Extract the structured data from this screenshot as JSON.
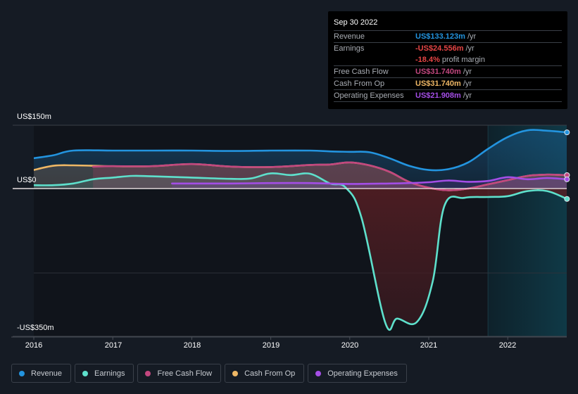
{
  "tooltip": {
    "date": "Sep 30 2022",
    "rows": [
      {
        "label": "Revenue",
        "value": "US$133.123m",
        "unit": "/yr",
        "color": "#2394df"
      },
      {
        "label": "Earnings",
        "value": "-US$24.556m",
        "unit": "/yr",
        "color": "#e64545"
      },
      {
        "label": "",
        "value": "-18.4%",
        "unit": "profit margin",
        "color": "#e64545"
      },
      {
        "label": "Free Cash Flow",
        "value": "US$31.740m",
        "unit": "/yr",
        "color": "#c2477f"
      },
      {
        "label": "Cash From Op",
        "value": "US$31.740m",
        "unit": "/yr",
        "color": "#eeb765"
      },
      {
        "label": "Operating Expenses",
        "value": "US$21.908m",
        "unit": "/yr",
        "color": "#a44ee6"
      }
    ]
  },
  "legend": [
    {
      "label": "Revenue",
      "color": "#2394df"
    },
    {
      "label": "Earnings",
      "color": "#5ee0cc"
    },
    {
      "label": "Free Cash Flow",
      "color": "#c2477f"
    },
    {
      "label": "Cash From Op",
      "color": "#eeb765"
    },
    {
      "label": "Operating Expenses",
      "color": "#a44ee6"
    }
  ],
  "chart_data": {
    "type": "line",
    "title": "",
    "xlabel": "",
    "ylabel": "",
    "y_tick_labels": [
      "US$150m",
      "US$0",
      "-US$350m"
    ],
    "y_ticks": [
      150,
      0,
      -350
    ],
    "ylim": [
      -350,
      150
    ],
    "x_tick_labels": [
      "2016",
      "2017",
      "2018",
      "2019",
      "2020",
      "2021",
      "2022"
    ],
    "xlim": [
      2016.0,
      2022.75
    ],
    "grid": true,
    "legend_position": "bottom-left",
    "highlight_start": 2021.75,
    "series": [
      {
        "name": "Revenue",
        "color": "#2394df",
        "fill": true,
        "x": [
          2016.0,
          2016.25,
          2016.5,
          2017.0,
          2017.5,
          2018.0,
          2018.5,
          2019.0,
          2019.5,
          2019.75,
          2020.0,
          2020.25,
          2020.5,
          2020.75,
          2021.0,
          2021.25,
          2021.5,
          2021.75,
          2022.0,
          2022.25,
          2022.5,
          2022.75
        ],
        "y": [
          72,
          79,
          90,
          90,
          90,
          90,
          89,
          90,
          90,
          88,
          87,
          86,
          72,
          54,
          44,
          46,
          62,
          94,
          122,
          138,
          137,
          133.1
        ]
      },
      {
        "name": "Cash From Op",
        "color": "#eeb765",
        "fill": true,
        "x": [
          2016.0,
          2016.25,
          2016.5,
          2017.0,
          2017.5,
          2018.0,
          2018.5,
          2019.0,
          2019.5,
          2019.75,
          2020.0,
          2020.25,
          2020.5,
          2020.75,
          2021.0,
          2021.25,
          2021.5,
          2021.75,
          2022.0,
          2022.25,
          2022.5,
          2022.75
        ],
        "y": [
          44,
          54,
          55,
          53,
          53,
          58,
          52,
          51,
          56,
          57,
          62,
          55,
          40,
          16,
          2,
          -4,
          0,
          10,
          20,
          30,
          33,
          31.7
        ]
      },
      {
        "name": "Free Cash Flow",
        "color": "#c2477f",
        "fill": true,
        "x": [
          2016.75,
          2017.0,
          2017.5,
          2018.0,
          2018.5,
          2019.0,
          2019.5,
          2019.75,
          2020.0,
          2020.25,
          2020.5,
          2020.75,
          2021.0,
          2021.25,
          2021.5,
          2021.75,
          2022.0,
          2022.25,
          2022.5,
          2022.75
        ],
        "y": [
          52,
          53,
          53,
          58,
          52,
          51,
          56,
          57,
          62,
          55,
          40,
          16,
          2,
          -4,
          0,
          10,
          20,
          30,
          33,
          31.7
        ]
      },
      {
        "name": "Earnings",
        "color": "#5ee0cc",
        "fill": true,
        "x": [
          2016.0,
          2016.25,
          2016.5,
          2016.75,
          2017.0,
          2017.25,
          2017.5,
          2018.0,
          2018.5,
          2018.75,
          2019.0,
          2019.25,
          2019.5,
          2019.75,
          2019.95,
          2020.15,
          2020.45,
          2020.6,
          2020.85,
          2021.05,
          2021.2,
          2021.45,
          2021.75,
          2022.0,
          2022.25,
          2022.5,
          2022.75
        ],
        "y": [
          8,
          8,
          12,
          22,
          26,
          30,
          29,
          26,
          23,
          24,
          36,
          32,
          35,
          12,
          2,
          -70,
          -318,
          -308,
          -316,
          -220,
          -40,
          -22,
          -20,
          -18,
          -6,
          -6,
          -24.6
        ]
      },
      {
        "name": "Operating Expenses",
        "color": "#a44ee6",
        "fill": true,
        "x": [
          2017.75,
          2018.0,
          2018.5,
          2019.0,
          2019.5,
          2020.0,
          2020.5,
          2020.75,
          2021.0,
          2021.25,
          2021.5,
          2021.75,
          2022.0,
          2022.25,
          2022.5,
          2022.75
        ],
        "y": [
          12,
          12,
          12,
          13,
          13,
          11,
          12,
          13,
          15,
          19,
          16,
          18,
          27,
          22,
          25,
          21.9
        ]
      }
    ]
  }
}
